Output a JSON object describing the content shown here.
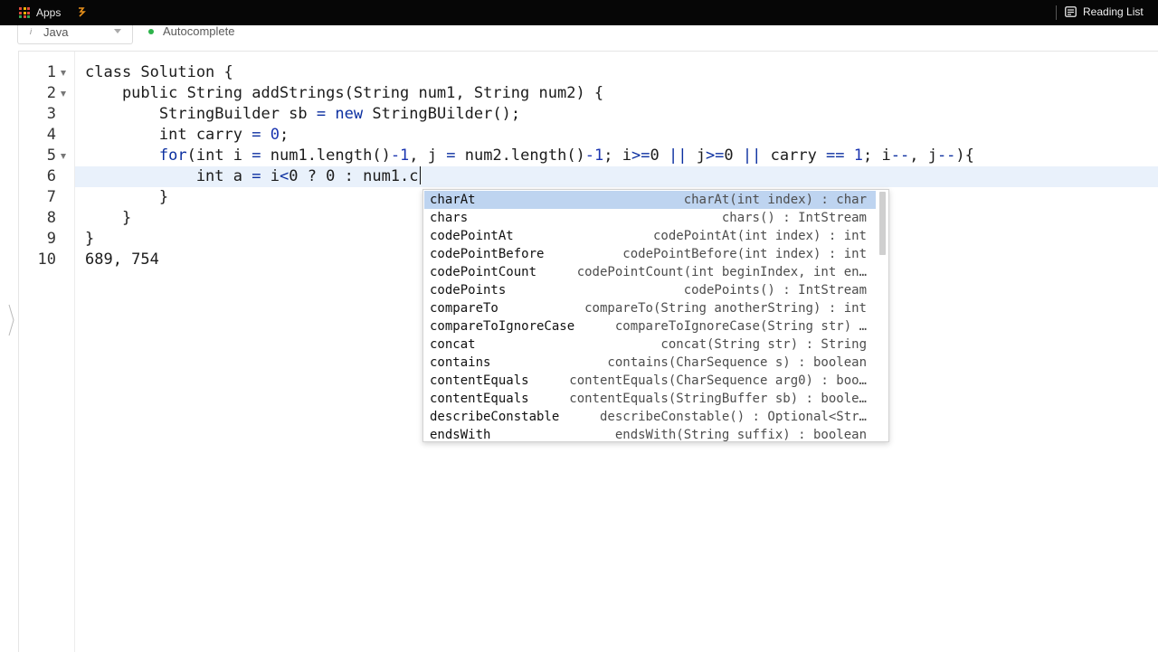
{
  "browser": {
    "apps_label": "Apps",
    "reading_list_label": "Reading List"
  },
  "toolbar": {
    "language": "Java",
    "autocomplete_label": "Autocomplete",
    "status_color": "#2db34a"
  },
  "editor": {
    "line_numbers": [
      "1",
      "2",
      "3",
      "4",
      "5",
      "6",
      "7",
      "8",
      "9",
      "10"
    ],
    "lines": {
      "l1": {
        "a": "class Solution {"
      },
      "l2": {
        "a": "    public String addStrings(String num1, String num2) {"
      },
      "l3": {
        "a": "        StringBuilder sb ",
        "op": "=",
        "kw": "new",
        "b": " StringBUilder();"
      },
      "l4": {
        "a": "        int carry ",
        "op": "=",
        "num": "0",
        "b": ";"
      },
      "l5": {
        "kw": "for",
        "a": "(int i ",
        "op1": "=",
        "b": " num1.length()",
        "n1": "-1",
        "c": ", j ",
        "op2": "=",
        "d": " num2.length()",
        "n2": "-1",
        "e": "; i",
        "op3": ">=",
        "f": "0 ",
        "op4": "||",
        "g": " j",
        "op5": ">=",
        "h": "0 ",
        "op6": "||",
        "i": " carry ",
        "op7": "==",
        "n3": " 1",
        "j": "; i",
        "op8": "--",
        "k": ", j",
        "op9": "--",
        "l": "){"
      },
      "l6": {
        "a": "            int a ",
        "op1": "=",
        "b": " i",
        "op2": "<",
        "c": "0 ? 0 : num1.c"
      },
      "l7": {
        "a": "        }"
      },
      "l8": {
        "a": "    }"
      },
      "l9": {
        "a": "}"
      },
      "l10": {
        "a": "689, 754"
      }
    }
  },
  "autocomplete": {
    "items": [
      {
        "name": "charAt",
        "signature": "charAt(int index) : char"
      },
      {
        "name": "chars",
        "signature": "chars() : IntStream"
      },
      {
        "name": "codePointAt",
        "signature": "codePointAt(int index) : int"
      },
      {
        "name": "codePointBefore",
        "signature": "codePointBefore(int index) : int"
      },
      {
        "name": "codePointCount",
        "signature": "codePointCount(int beginIndex, int en…"
      },
      {
        "name": "codePoints",
        "signature": "codePoints() : IntStream"
      },
      {
        "name": "compareTo",
        "signature": "compareTo(String anotherString) : int"
      },
      {
        "name": "compareToIgnoreCase",
        "signature": "compareToIgnoreCase(String str) …"
      },
      {
        "name": "concat",
        "signature": "concat(String str) : String"
      },
      {
        "name": "contains",
        "signature": "contains(CharSequence s) : boolean"
      },
      {
        "name": "contentEquals",
        "signature": "contentEquals(CharSequence arg0) : boo…"
      },
      {
        "name": "contentEquals",
        "signature": "contentEquals(StringBuffer sb) : boole…"
      },
      {
        "name": "describeConstable",
        "signature": "describeConstable() : Optional<Str…"
      },
      {
        "name": "endsWith",
        "signature": "endsWith(String suffix) : boolean"
      }
    ],
    "selected": "charAt"
  }
}
